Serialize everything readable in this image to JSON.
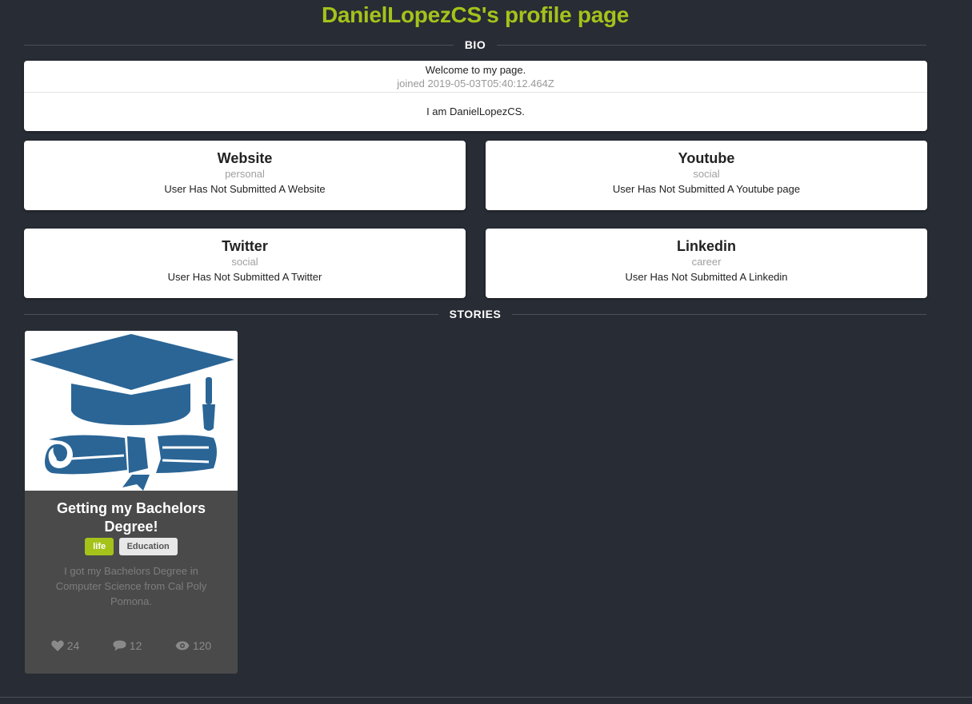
{
  "page": {
    "title": "DanielLopezCS's profile page"
  },
  "sections": {
    "bio_label": "BIO",
    "stories_label": "STORIES"
  },
  "bio": {
    "welcome": "Welcome to my page.",
    "joined": "joined 2019-05-03T05:40:12.464Z",
    "description": "I am DanielLopezCS."
  },
  "links": [
    {
      "title": "Website",
      "category": "personal",
      "status": "User Has Not Submitted A Website"
    },
    {
      "title": "Youtube",
      "category": "social",
      "status": "User Has Not Submitted A Youtube page"
    },
    {
      "title": "Twitter",
      "category": "social",
      "status": "User Has Not Submitted A Twitter"
    },
    {
      "title": "Linkedin",
      "category": "career",
      "status": "User Has Not Submitted A Linkedin"
    }
  ],
  "stories": [
    {
      "title": "Getting my Bachelors Degree!",
      "image_icon": "graduation-cap-diploma-icon",
      "tags": [
        "life",
        "Education"
      ],
      "description": "I got my Bachelors Degree in Computer Science from Cal Poly Pomona.",
      "likes": "24",
      "comments": "12",
      "views": "120"
    }
  ],
  "colors": {
    "background": "#282c34",
    "accent": "#a5c21b",
    "card": "#ffffff",
    "story_card": "#4a4a4a",
    "illustration": "#2a6596"
  }
}
